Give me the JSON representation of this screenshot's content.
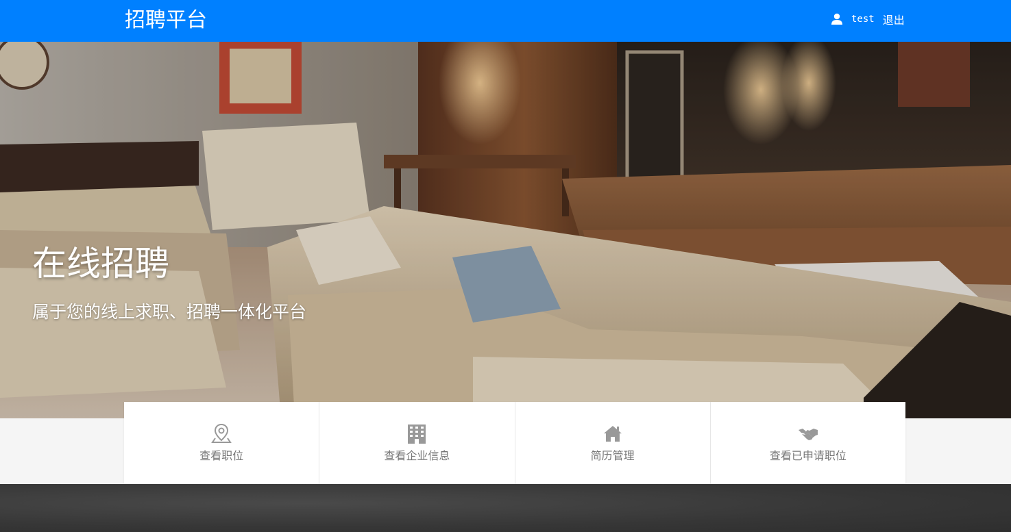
{
  "header": {
    "brand": "招聘平台",
    "username": "test",
    "logout_label": "退出",
    "background_color": "#0080ff"
  },
  "hero": {
    "title": "在线招聘",
    "subtitle": "属于您的线上求职、招聘一体化平台"
  },
  "features": [
    {
      "label": "查看职位",
      "icon": "map-pin-icon"
    },
    {
      "label": "查看企业信息",
      "icon": "building-icon"
    },
    {
      "label": "简历管理",
      "icon": "home-icon"
    },
    {
      "label": "查看已申请职位",
      "icon": "handshake-icon"
    }
  ],
  "section": {
    "heading": ""
  }
}
